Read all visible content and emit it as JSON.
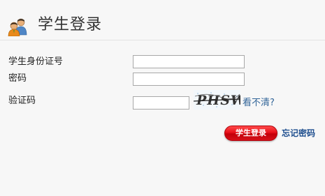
{
  "header": {
    "title": "学生登录",
    "icon": "users-icon"
  },
  "form": {
    "id_label": "学生身份证号",
    "id_value": "",
    "password_label": "密码",
    "password_value": "",
    "captcha_label": "验证码",
    "captcha_value": "",
    "captcha_text": "PHSW",
    "cant_see_link": "看不清?"
  },
  "actions": {
    "login_label": "学生登录",
    "forgot_link": "忘记密码"
  },
  "colors": {
    "background": "#f7f7f7",
    "login_button": "#e8101a",
    "link": "#336699",
    "forgot_link": "#1f4f8f"
  }
}
